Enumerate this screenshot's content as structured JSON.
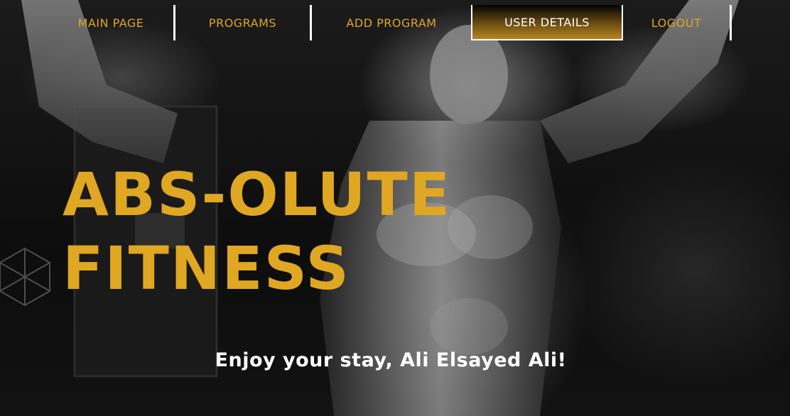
{
  "nav": {
    "items": [
      {
        "label": "MAIN PAGE"
      },
      {
        "label": "PROGRAMS"
      },
      {
        "label": "ADD PROGRAM"
      },
      {
        "label": "USER DETAILS"
      },
      {
        "label": "LOGOUT"
      }
    ],
    "active_index": 3,
    "colors": {
      "accent": "#e0a722",
      "active_text": "#ffffff"
    }
  },
  "hero": {
    "title_line1": "ABS-OLUTE",
    "title_line2": "FITNESS"
  },
  "welcome": {
    "text": "Enjoy your stay, Ali Elsayed Ali!"
  }
}
